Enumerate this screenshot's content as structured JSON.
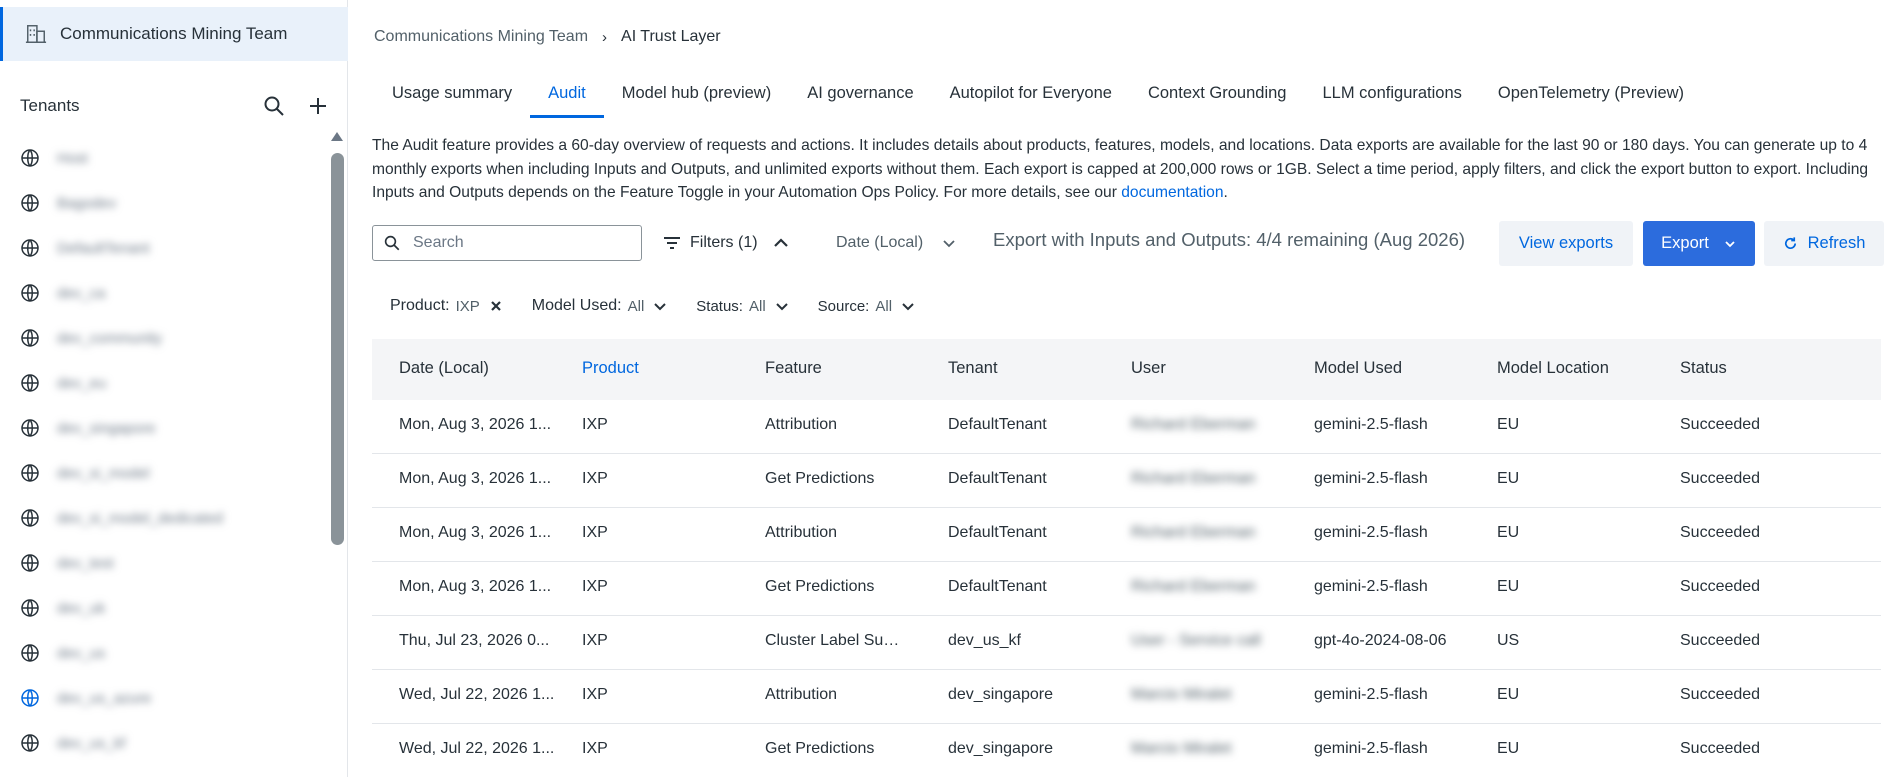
{
  "sidebar": {
    "org_name": "Communications Mining Team",
    "tenants_label": "Tenants",
    "tenants": [
      {
        "name": "Host"
      },
      {
        "name": "Bagodev"
      },
      {
        "name": "DefaultTenant"
      },
      {
        "name": "dev_ca"
      },
      {
        "name": "dev_community"
      },
      {
        "name": "dev_eu"
      },
      {
        "name": "dev_singapore"
      },
      {
        "name": "dev_si_model"
      },
      {
        "name": "dev_si_model_dedicated"
      },
      {
        "name": "dev_test"
      },
      {
        "name": "dev_uk"
      },
      {
        "name": "dev_us"
      },
      {
        "name": "dev_us_azure"
      },
      {
        "name": "dev_us_kf"
      }
    ]
  },
  "breadcrumb": {
    "parent": "Communications Mining Team",
    "separator": "›",
    "current": "AI Trust Layer"
  },
  "tabs": [
    {
      "label": "Usage summary"
    },
    {
      "label": "Audit"
    },
    {
      "label": "Model hub (preview)"
    },
    {
      "label": "AI governance"
    },
    {
      "label": "Autopilot for Everyone"
    },
    {
      "label": "Context Grounding"
    },
    {
      "label": "LLM configurations"
    },
    {
      "label": "OpenTelemetry (Preview)"
    }
  ],
  "active_tab": "Audit",
  "description": {
    "text": "The Audit feature provides a 60-day overview of requests and actions. It includes details about products, features, models, and locations. Data exports are available for the last 90 or 180 days. You can generate up to 4 monthly exports when including Inputs and Outputs, and unlimited exports without them. Each export is capped at 200,000 rows or 1GB. Select a time period, apply filters, and click the export button to export. Including Inputs and Outputs depends on the Feature Toggle in your Automation Ops Policy. For more details, see our ",
    "link": "documentation",
    "tail": "."
  },
  "toolbar": {
    "search_placeholder": "Search",
    "filters_label": "Filters (1)",
    "date_label": "Date (Local)",
    "export_info": "Export with Inputs and Outputs: 4/4 remaining (Aug 2026)",
    "view_exports": "View exports",
    "export": "Export",
    "refresh": "Refresh"
  },
  "chips": [
    {
      "key": "Product:",
      "value": "IXP"
    },
    {
      "key": "Model Used:",
      "value": "All"
    },
    {
      "key": "Status:",
      "value": "All"
    },
    {
      "key": "Source:",
      "value": "All"
    }
  ],
  "table": {
    "columns": [
      "Date (Local)",
      "Product",
      "Feature",
      "Tenant",
      "User",
      "Model Used",
      "Model Location",
      "Status"
    ],
    "rows": [
      [
        "Mon, Aug 3, 2026 1...",
        "IXP",
        "Attribution",
        "DefaultTenant",
        "Richard Eberman",
        "gemini-2.5-flash",
        "EU",
        "Succeeded"
      ],
      [
        "Mon, Aug 3, 2026 1...",
        "IXP",
        "Get Predictions",
        "DefaultTenant",
        "Richard Eberman",
        "gemini-2.5-flash",
        "EU",
        "Succeeded"
      ],
      [
        "Mon, Aug 3, 2026 1...",
        "IXP",
        "Attribution",
        "DefaultTenant",
        "Richard Eberman",
        "gemini-2.5-flash",
        "EU",
        "Succeeded"
      ],
      [
        "Mon, Aug 3, 2026 1...",
        "IXP",
        "Get Predictions",
        "DefaultTenant",
        "Richard Eberman",
        "gemini-2.5-flash",
        "EU",
        "Succeeded"
      ],
      [
        "Thu, Jul 23, 2026 0...",
        "IXP",
        "Cluster Label Sugg...",
        "dev_us_kf",
        "User - Service call",
        "gpt-4o-2024-08-06",
        "US",
        "Succeeded"
      ],
      [
        "Wed, Jul 22, 2026 1...",
        "IXP",
        "Attribution",
        "dev_singapore",
        "Marcio Miralet",
        "gemini-2.5-flash",
        "EU",
        "Succeeded"
      ],
      [
        "Wed, Jul 22, 2026 1...",
        "IXP",
        "Get Predictions",
        "dev_singapore",
        "Marcio Miralet",
        "gemini-2.5-flash",
        "EU",
        "Succeeded"
      ]
    ]
  },
  "colors": {
    "accent": "#0067df",
    "export_button": "#2c6cdd",
    "header_bg": "#f4f5f7"
  }
}
